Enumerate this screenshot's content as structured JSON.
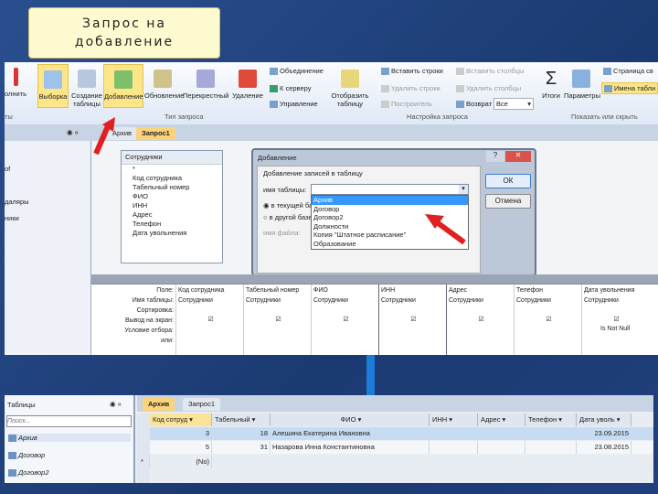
{
  "slide": {
    "title_line1": "Запрос на",
    "title_line2": "добавление"
  },
  "ribbon": {
    "cut_left_1": "олнить",
    "cut_left_2": "ты",
    "buttons": {
      "select": "Выборка",
      "make_table": "Создание таблицы",
      "append": "Добавление",
      "update": "Обновление",
      "crosstab": "Перекрестный",
      "delete": "Удаление",
      "show_table": "Отобразить таблицу",
      "totals": "Итоги",
      "parameters": "Параметры"
    },
    "small": {
      "union": "Объединение",
      "passthrough": "К серверу",
      "data_def": "Управление",
      "insert_rows": "Вставить строки",
      "delete_rows": "Удалить строки",
      "builder": "Построитель",
      "insert_cols": "Вставить столбцы",
      "delete_cols": "Удалить столбцы",
      "return": "Возврат",
      "return_value": "Все",
      "prop_sheet": "Страница св",
      "table_names": "Имена табли"
    },
    "groups": {
      "query_type": "Тип запроса",
      "query_setup": "Настройка запроса",
      "show_hide": "Показать или скрыть",
      "results": "ты"
    }
  },
  "tabs": {
    "archive": "Архив",
    "query1": "Запрос1"
  },
  "nav_cut": [
    "of",
    "даляры",
    "ники"
  ],
  "table_box": {
    "title": "Сотрудники",
    "fields": [
      "*",
      "Код сотрудника",
      "Табельный номер",
      "ФИО",
      "ИНН",
      "Адрес",
      "Телефон",
      "Дата увольнения"
    ]
  },
  "dialog": {
    "title": "Добавление",
    "group": "Добавление записей в таблицу",
    "table_label": "имя таблицы:",
    "radio_current": "в текущей базе данных",
    "radio_other": "в другой базе данных:",
    "file_label": "имя файла:",
    "ok": "ОК",
    "cancel": "Отмена",
    "options": [
      "Архив",
      "Договор",
      "Договор2",
      "Должности",
      "Копия \"Штатное расписание\"",
      "Образование"
    ]
  },
  "grid": {
    "row_labels": [
      "Поле:",
      "Имя таблицы:",
      "Сортировка:",
      "Вывод на экран:",
      "Условие отбора:",
      "или:"
    ],
    "columns": [
      {
        "field": "Код сотрудника",
        "table": "Сотрудники",
        "criteria": ""
      },
      {
        "field": "Табельный номер",
        "table": "Сотрудники",
        "criteria": ""
      },
      {
        "field": "ФИО",
        "table": "Сотрудники",
        "criteria": ""
      },
      {
        "field": "ИНН",
        "table": "Сотрудники",
        "criteria": ""
      },
      {
        "field": "Адрес",
        "table": "Сотрудники",
        "criteria": ""
      },
      {
        "field": "Телефон",
        "table": "Сотрудники",
        "criteria": ""
      },
      {
        "field": "Дата увольнения",
        "table": "Сотрудники",
        "criteria": "Is Not Null"
      }
    ],
    "check": "☑"
  },
  "bottom": {
    "nav_title": "Таблицы",
    "search_placeholder": "Поиск...",
    "tables": [
      "Архив",
      "Договор",
      "Договор2"
    ],
    "tabs": {
      "archive": "Архив",
      "query1": "Запрос1"
    },
    "headers": [
      "Код сотруд ▾",
      "Табельный ▾",
      "ФИО ▾",
      "ИНН ▾",
      "Адрес ▾",
      "Телефон ▾",
      "Дата уволь ▾"
    ],
    "rows": [
      [
        "3",
        "18",
        "Алешина Екатерина Ивановна",
        "",
        "",
        "",
        "23.09.2015"
      ],
      [
        "5",
        "31",
        "Назарова Инна Константиновна",
        "",
        "",
        "",
        "23.08.2015"
      ]
    ],
    "new_row": [
      "*",
      "(No)"
    ]
  },
  "colors": {
    "slide_bg": "#1f3f7a",
    "title_bg": "#fffbd0",
    "highlight": "#fde58a",
    "red_arrow": "#e02020",
    "blue_arrow": "#1e7ad8"
  }
}
